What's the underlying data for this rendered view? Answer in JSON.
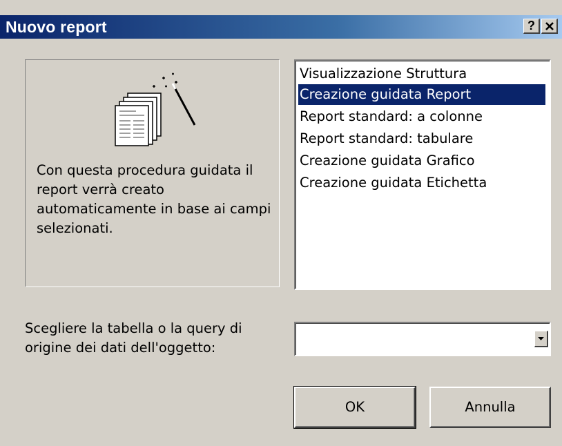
{
  "window": {
    "title": "Nuovo report",
    "help_button": "?",
    "close_button": "✕"
  },
  "info_panel": {
    "icon": "report-wizard-icon",
    "description": "Con questa procedura guidata il report verrà creato automaticamente in base ai campi selezionati."
  },
  "report_types": {
    "items": [
      {
        "label": "Visualizzazione Struttura",
        "selected": false
      },
      {
        "label": "Creazione guidata Report",
        "selected": true
      },
      {
        "label": "Report standard: a colonne",
        "selected": false
      },
      {
        "label": "Report standard: tabulare",
        "selected": false
      },
      {
        "label": "Creazione guidata Grafico",
        "selected": false
      },
      {
        "label": "Creazione guidata Etichetta",
        "selected": false
      }
    ]
  },
  "source": {
    "label": "Scegliere la tabella o la query di origine dei dati dell'oggetto:",
    "value": ""
  },
  "buttons": {
    "ok": "OK",
    "cancel": "Annulla"
  },
  "colors": {
    "title_bar": "#0a246a",
    "selection": "#0a246a",
    "face": "#d4d0c8"
  }
}
